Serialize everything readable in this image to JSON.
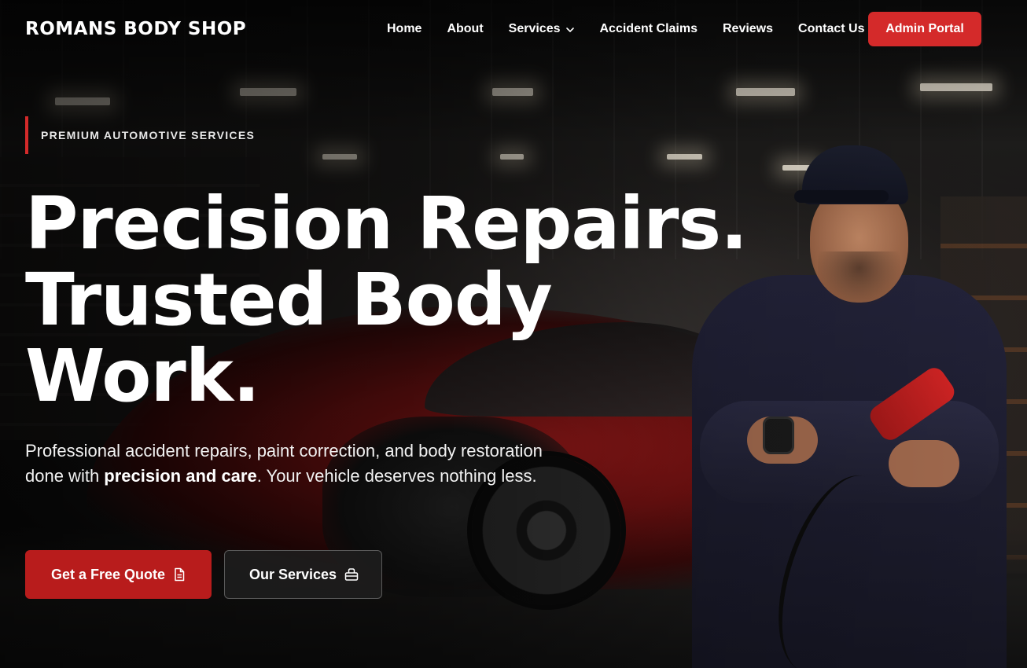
{
  "nav": {
    "brand": "ROMANS BODY SHOP",
    "links": [
      {
        "label": "Home"
      },
      {
        "label": "About"
      },
      {
        "label": "Services",
        "has_dropdown": true
      },
      {
        "label": "Accident Claims"
      },
      {
        "label": "Reviews"
      },
      {
        "label": "Contact Us"
      }
    ],
    "admin_button": "Admin Portal"
  },
  "hero": {
    "eyebrow": "PREMIUM AUTOMOTIVE SERVICES",
    "headline": [
      "Precision Repairs.",
      "Trusted Body",
      "Work."
    ],
    "lede_before": "Professional accident repairs, paint correction, and body restoration done with ",
    "lede_bold": "precision and care",
    "lede_after": ". Your vehicle deserves nothing less.",
    "primary_button": "Get a Free Quote",
    "secondary_button": "Our Services"
  },
  "icons": {
    "dropdown": "chevron-down-icon",
    "quote": "document-icon",
    "services": "toolbox-icon"
  },
  "colors": {
    "accent": "#d42a2a",
    "primary_button": "#b81c1c",
    "text": "#ffffff"
  }
}
